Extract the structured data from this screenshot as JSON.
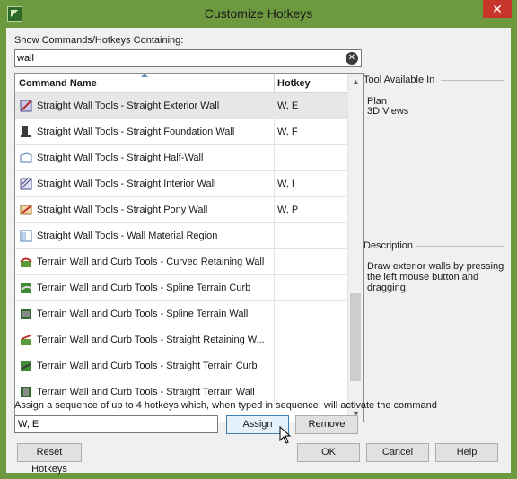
{
  "window": {
    "title": "Customize Hotkeys"
  },
  "search": {
    "label": "Show Commands/Hotkeys Containing:",
    "value": "wall"
  },
  "table": {
    "columns": [
      "Command Name",
      "Hotkey"
    ],
    "rows": [
      {
        "icon": "exterior-wall-icon",
        "name": "Straight Wall Tools - Straight Exterior Wall",
        "hotkey": "W, E",
        "selected": true
      },
      {
        "icon": "foundation-wall-icon",
        "name": "Straight Wall Tools - Straight Foundation Wall",
        "hotkey": "W, F"
      },
      {
        "icon": "half-wall-icon",
        "name": "Straight Wall Tools - Straight Half-Wall",
        "hotkey": ""
      },
      {
        "icon": "interior-wall-icon",
        "name": "Straight Wall Tools - Straight Interior Wall",
        "hotkey": "W, I"
      },
      {
        "icon": "pony-wall-icon",
        "name": "Straight Wall Tools - Straight Pony Wall",
        "hotkey": "W, P"
      },
      {
        "icon": "wall-material-region-icon",
        "name": "Straight Wall Tools - Wall Material Region",
        "hotkey": ""
      },
      {
        "icon": "curved-retaining-wall-icon",
        "name": "Terrain Wall and Curb Tools - Curved Retaining Wall",
        "hotkey": ""
      },
      {
        "icon": "spline-terrain-curb-icon",
        "name": "Terrain Wall and Curb Tools - Spline Terrain Curb",
        "hotkey": ""
      },
      {
        "icon": "spline-terrain-wall-icon",
        "name": "Terrain Wall and Curb Tools - Spline Terrain Wall",
        "hotkey": ""
      },
      {
        "icon": "straight-retaining-wall-icon",
        "name": "Terrain Wall and Curb Tools - Straight Retaining W...",
        "hotkey": ""
      },
      {
        "icon": "straight-terrain-curb-icon",
        "name": "Terrain Wall and Curb Tools - Straight Terrain Curb",
        "hotkey": ""
      },
      {
        "icon": "straight-terrain-wall-icon",
        "name": "Terrain Wall and Curb Tools - Straight Terrain Wall",
        "hotkey": ""
      }
    ]
  },
  "tool_available": {
    "header": "Tool Available In",
    "items": [
      "Plan",
      "3D Views"
    ]
  },
  "description": {
    "header": "Description",
    "lines": [
      "Draw exterior walls by pressing",
      "the left mouse button and",
      "dragging."
    ]
  },
  "assign": {
    "instruction": "Assign a sequence of up to 4 hotkeys which, when typed in sequence, will activate the command",
    "value": "W, E",
    "assign_label": "Assign",
    "remove_label": "Remove"
  },
  "footer": {
    "reset_label": "Reset Hotkeys",
    "ok_label": "OK",
    "cancel_label": "Cancel",
    "help_label": "Help"
  },
  "colors": {
    "titlebar": "#6d9a3f",
    "close": "#c7352b",
    "dialog_bg": "#f0f0f0",
    "selected_row": "#e7e7e7"
  }
}
